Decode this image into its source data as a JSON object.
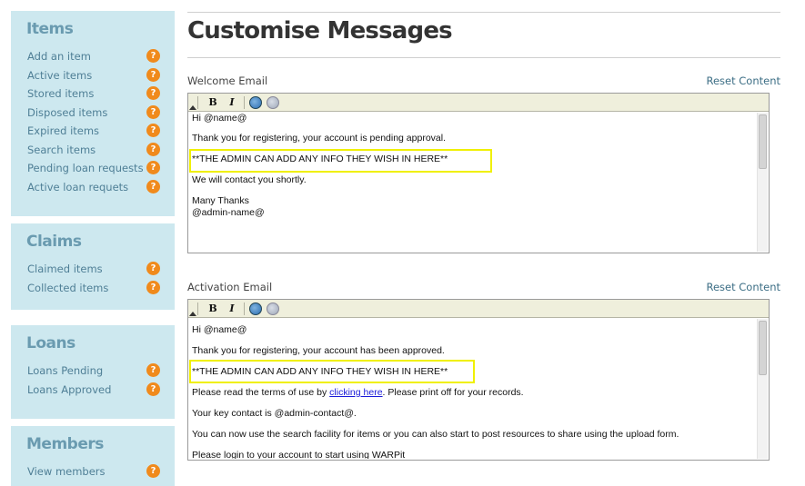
{
  "sidebar": {
    "sections": [
      {
        "title": "Items",
        "items": [
          "Add an item",
          "Active items",
          "Stored items",
          "Disposed items",
          "Expired items",
          "Search items",
          "Pending loan requests",
          "Active loan requets"
        ]
      },
      {
        "title": "Claims",
        "items": [
          "Claimed items",
          "Collected items"
        ]
      },
      {
        "title": "Loans",
        "items": [
          "Loans Pending",
          "Loans Approved"
        ]
      },
      {
        "title": "Members",
        "items": [
          "View members"
        ]
      }
    ],
    "help_glyph": "?"
  },
  "page": {
    "title": "Customise Messages"
  },
  "welcome": {
    "label": "Welcome Email",
    "reset": "Reset Content",
    "lines": {
      "l1": "Hi @name@",
      "l2": "Thank you for registering, your account is pending approval.",
      "l3": "**THE ADMIN CAN ADD ANY INFO THEY WISH IN HERE**",
      "l4": "We will contact you shortly.",
      "l5": "Many Thanks",
      "l6": "@admin-name@"
    }
  },
  "activation": {
    "label": "Activation Email",
    "reset": "Reset Content",
    "lines": {
      "l1": "Hi @name@",
      "l2": "Thank you for registering, your account has been approved.",
      "l3": "**THE ADMIN CAN ADD ANY INFO THEY WISH IN HERE**",
      "l4a": "Please read the terms of use by ",
      "l4link": "clicking here",
      "l4b": ". Please print off for your records.",
      "l5": "Your key contact is @admin-contact@.",
      "l6": "You can now use the search facility for items or you can also start to post resources to share using the upload form.",
      "l7": "Please login to your account to start using WARPit"
    }
  },
  "toolbar": {
    "bold": "B",
    "italic": "I"
  },
  "colors": {
    "sidebar_bg": "#cde8ef",
    "sidebar_title": "#6a9bb0",
    "help_icon": "#f08a1c",
    "highlight": "#f0f000",
    "link": "#3c6e85"
  }
}
